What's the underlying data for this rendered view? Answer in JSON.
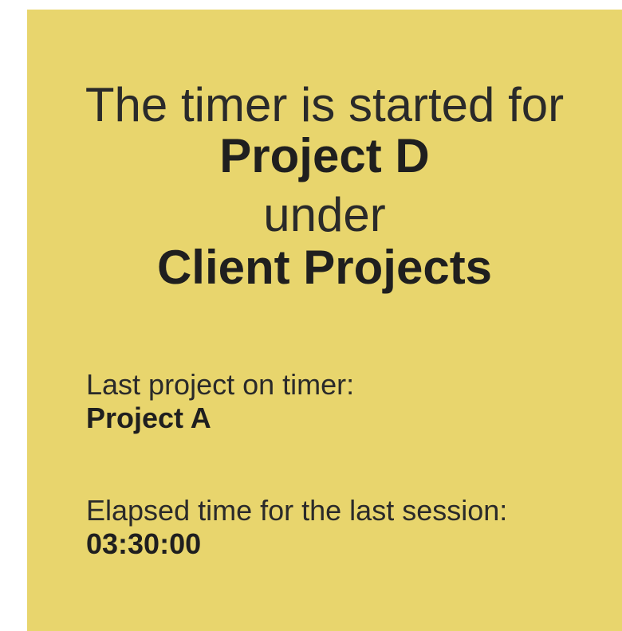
{
  "card": {
    "background": "#e8d56d",
    "headline": {
      "prefix": "The timer is started for",
      "project": "Project D",
      "connector": "under",
      "client": "Client Projects"
    },
    "last_project": {
      "label": "Last project on timer:",
      "value": "Project A"
    },
    "elapsed": {
      "label": "Elapsed time for the last session:",
      "value": "03:30:00"
    }
  }
}
